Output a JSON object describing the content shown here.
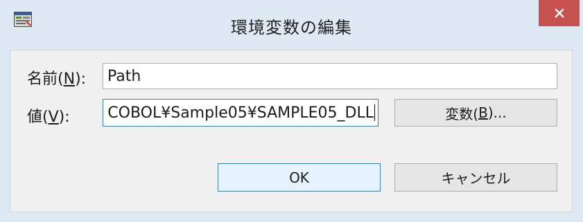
{
  "dialog": {
    "title": "環境変数の編集",
    "app_icon": "window-icon",
    "close_icon": "close-icon"
  },
  "fields": {
    "name": {
      "label_prefix": "名前(",
      "label_mnemonic": "N",
      "label_suffix": "):",
      "value": "Path"
    },
    "value": {
      "label_prefix": "値(",
      "label_mnemonic": "V",
      "label_suffix": "):",
      "value": "COBOL¥Sample05¥SAMPLE05_DLL"
    }
  },
  "buttons": {
    "variable": {
      "prefix": "変数(",
      "mnemonic": "B",
      "suffix": ")..."
    },
    "ok": "OK",
    "cancel": "キャンセル"
  },
  "colors": {
    "close_button": "#c75050",
    "frame": "#dfe9f3",
    "client": "#f0f0f0",
    "focus_border": "#3c7fb1"
  }
}
